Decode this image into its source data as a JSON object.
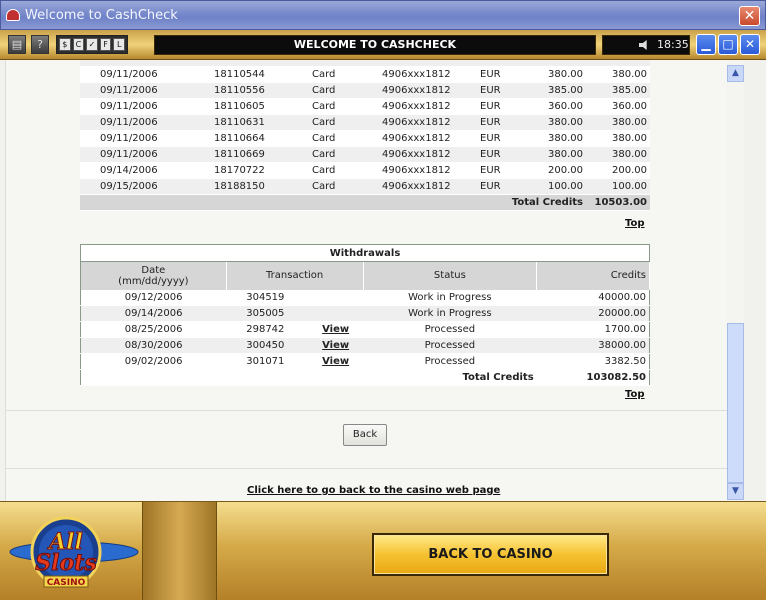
{
  "window": {
    "title": "Welcome to CashCheck"
  },
  "toolbar": {
    "group_buttons": [
      "$",
      "C",
      "✓",
      "F",
      "L"
    ],
    "banner": "WELCOME TO CASHCHECK",
    "time": "18:35"
  },
  "credits": {
    "rows": [
      [
        "09/11/2006",
        "18110544",
        "Card",
        "4906xxx1812",
        "EUR",
        "380.00",
        "380.00"
      ],
      [
        "09/11/2006",
        "18110556",
        "Card",
        "4906xxx1812",
        "EUR",
        "385.00",
        "385.00"
      ],
      [
        "09/11/2006",
        "18110605",
        "Card",
        "4906xxx1812",
        "EUR",
        "360.00",
        "360.00"
      ],
      [
        "09/11/2006",
        "18110631",
        "Card",
        "4906xxx1812",
        "EUR",
        "380.00",
        "380.00"
      ],
      [
        "09/11/2006",
        "18110664",
        "Card",
        "4906xxx1812",
        "EUR",
        "380.00",
        "380.00"
      ],
      [
        "09/11/2006",
        "18110669",
        "Card",
        "4906xxx1812",
        "EUR",
        "380.00",
        "380.00"
      ],
      [
        "09/14/2006",
        "18170722",
        "Card",
        "4906xxx1812",
        "EUR",
        "200.00",
        "200.00"
      ],
      [
        "09/15/2006",
        "18188150",
        "Card",
        "4906xxx1812",
        "EUR",
        "100.00",
        "100.00"
      ]
    ],
    "total_label": "Total Credits",
    "total_value": "10503.00",
    "top_link": "Top"
  },
  "withdrawals": {
    "caption": "Withdrawals",
    "headers": {
      "date_line1": "Date",
      "date_line2": "(mm/dd/yyyy)",
      "transaction": "Transaction",
      "status": "Status",
      "credits": "Credits"
    },
    "rows": [
      {
        "date": "09/12/2006",
        "transaction": "304519",
        "view": "",
        "status": "Work in Progress",
        "credits": "40000.00"
      },
      {
        "date": "09/14/2006",
        "transaction": "305005",
        "view": "",
        "status": "Work in Progress",
        "credits": "20000.00"
      },
      {
        "date": "08/25/2006",
        "transaction": "298742",
        "view": "View",
        "status": "Processed",
        "credits": "1700.00"
      },
      {
        "date": "08/30/2006",
        "transaction": "300450",
        "view": "View",
        "status": "Processed",
        "credits": "38000.00"
      },
      {
        "date": "09/02/2006",
        "transaction": "301071",
        "view": "View",
        "status": "Processed",
        "credits": "3382.50"
      }
    ],
    "total_label": "Total Credits",
    "total_value": "103082.50",
    "top_link": "Top"
  },
  "back_button": "Back",
  "bottom_link": "Click here to go back to the casino web page",
  "footer": {
    "logo_line1": "All",
    "logo_line2": "Slots",
    "logo_line3": "CASINO",
    "back_to_casino": "BACK TO CASINO"
  },
  "colors": {
    "gold": "#d5a948",
    "button_gold": "#f5c232",
    "titlebar": "#7b8ccc"
  }
}
